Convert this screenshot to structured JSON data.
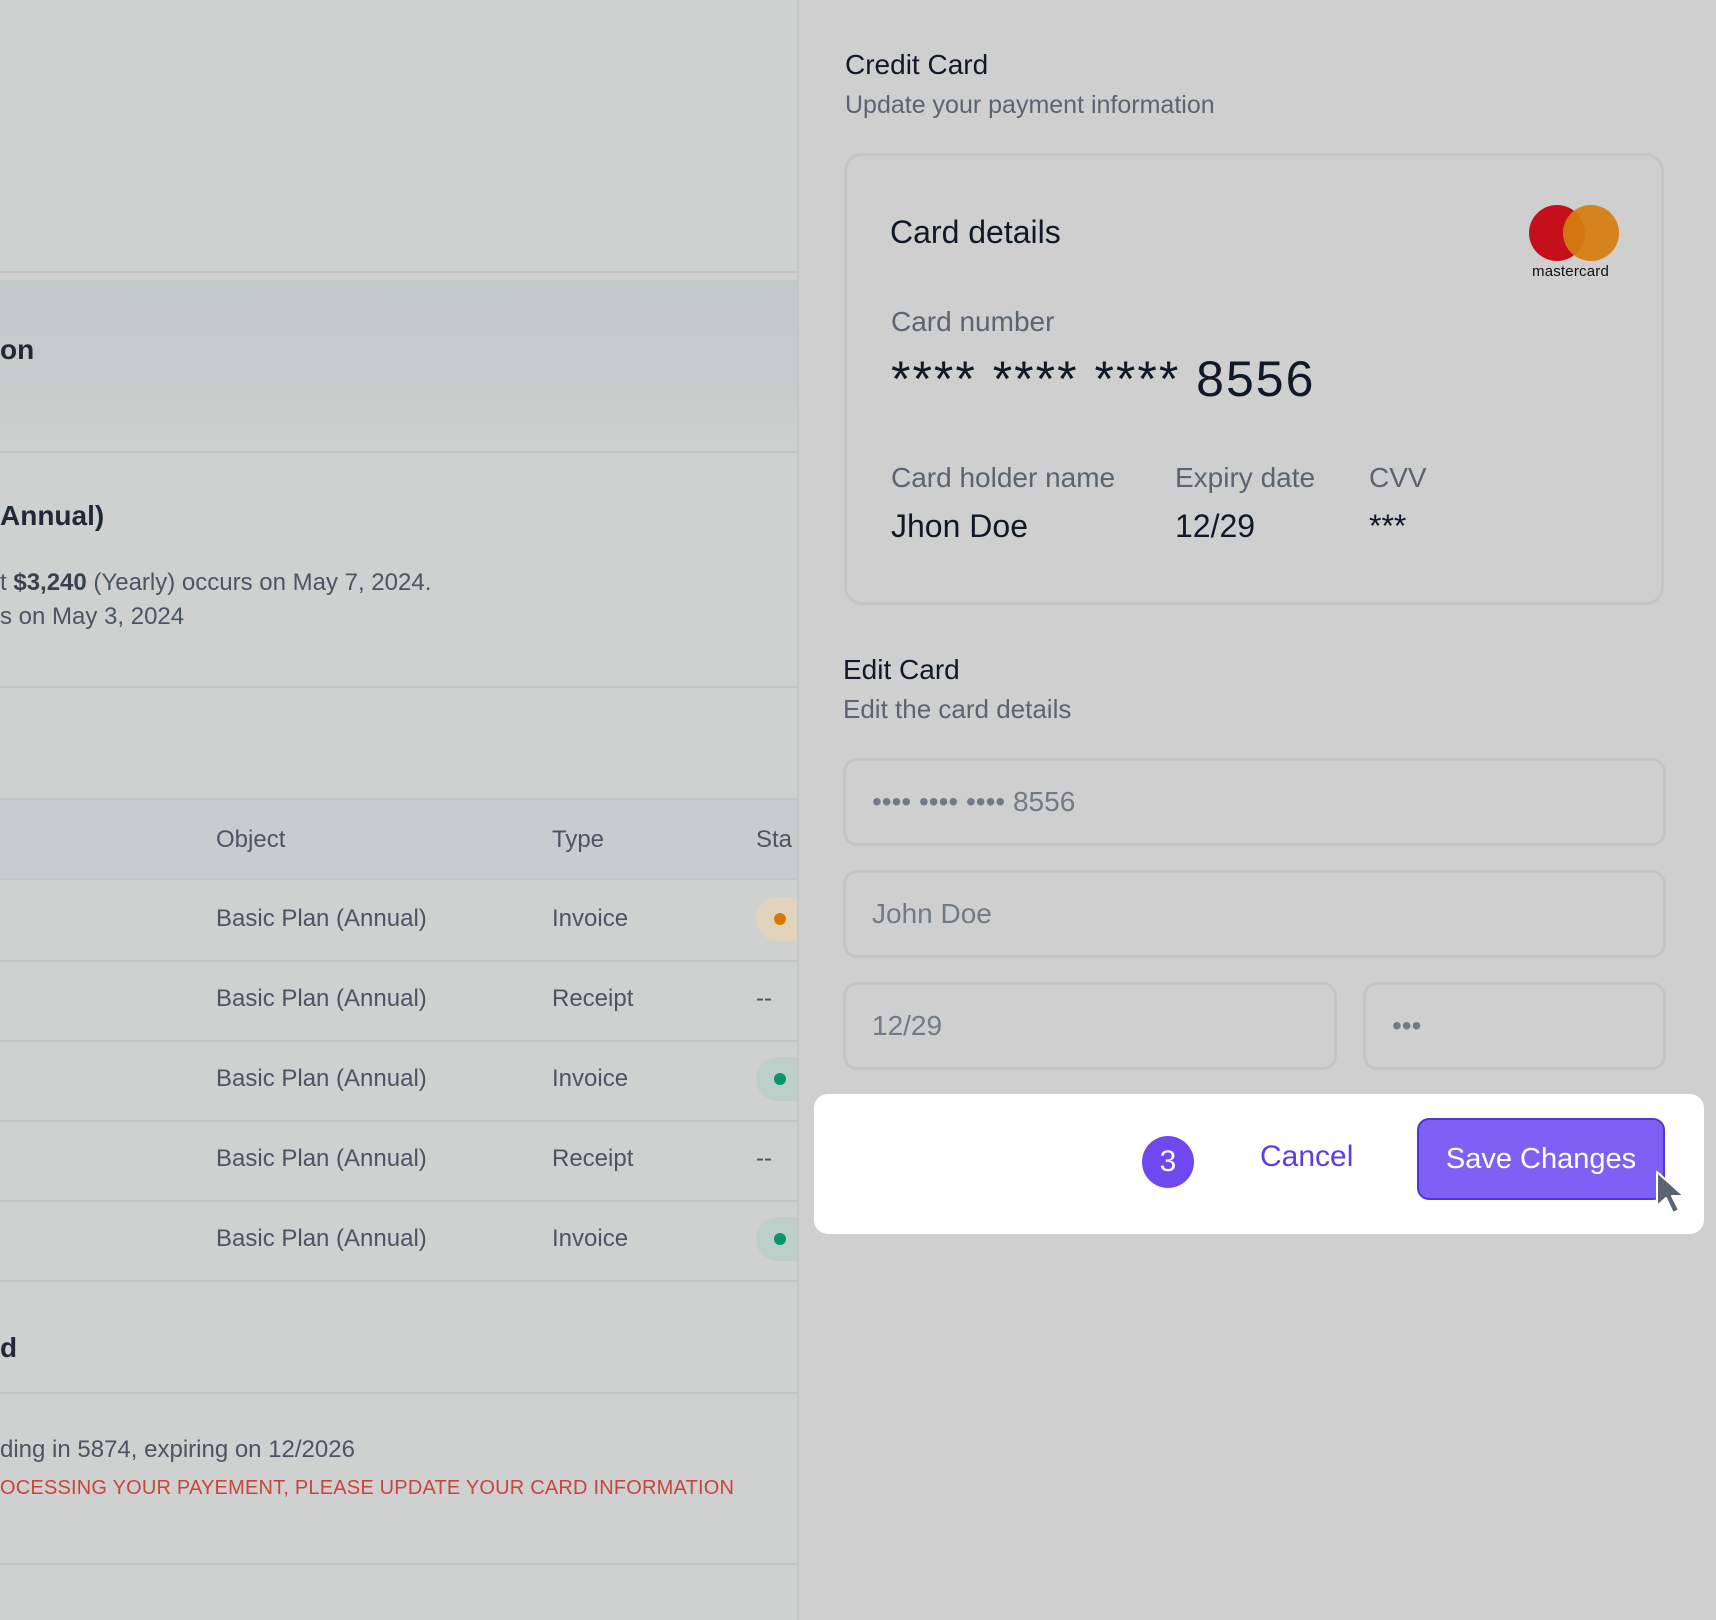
{
  "left": {
    "section_title_partial": "on",
    "plan": {
      "title_partial": "Annual)",
      "line1_prefix": "t ",
      "line1_amount": "$3,240",
      "line1_suffix": " (Yearly) occurs on May 7, 2024.",
      "line2": "s on May 3, 2024"
    },
    "table": {
      "headers": [
        "Object",
        "Type",
        "Sta"
      ],
      "rows": [
        {
          "object": "Basic Plan (Annual)",
          "type": "Invoice",
          "status": "dot-orange"
        },
        {
          "object": "Basic Plan (Annual)",
          "type": "Receipt",
          "status": "--"
        },
        {
          "object": "Basic Plan (Annual)",
          "type": "Invoice",
          "status": "dot-green"
        },
        {
          "object": "Basic Plan (Annual)",
          "type": "Receipt",
          "status": "--"
        },
        {
          "object": "Basic Plan (Annual)",
          "type": "Invoice",
          "status": "dot-green"
        }
      ]
    },
    "payment_section_title_partial": "d",
    "card_line": "ding in 5874, expiring on 12/2026",
    "warning": "OCESSING YOUR PAYEMENT, PLEASE UPDATE YOUR CARD INFORMATION"
  },
  "panel": {
    "title": "Credit Card",
    "subtitle": "Update your payment information",
    "card": {
      "heading": "Card details",
      "brand": "mastercard",
      "number_label": "Card number",
      "number_value": "**** **** **** 8556",
      "holder_label": "Card holder name",
      "holder_value": "Jhon Doe",
      "expiry_label": "Expiry date",
      "expiry_value": "12/29",
      "cvv_label": "CVV",
      "cvv_value": "***"
    },
    "edit": {
      "title": "Edit Card",
      "subtitle": "Edit the card details",
      "number_value": "•••• •••• •••• 8556",
      "name_value": "John Doe",
      "expiry_value": "12/29",
      "cvv_value": "•••"
    },
    "footer": {
      "step_number": "3",
      "cancel_label": "Cancel",
      "save_label": "Save Changes"
    }
  },
  "colors": {
    "accent": "#7c62f4",
    "step_badge": "#7048f0",
    "warning": "#c9453b",
    "status_orange": "#d97706",
    "status_green": "#059669"
  },
  "icons": [
    "mastercard-logo-icon",
    "cursor-pointer-icon",
    "status-dot-icon"
  ]
}
